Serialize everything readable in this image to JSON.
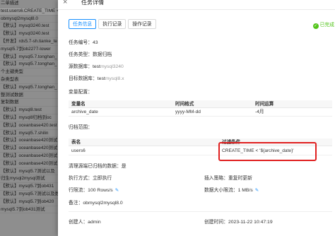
{
  "left_list": [
    "二单描述",
    "test.users6.CREATE_TIME <",
    "obmysql2mysql8.0",
    "【默认】mysql3240.test",
    "【默认】mysql3240.test",
    "【开发】rds5.7-sh.tianke_te",
    "mysql5.7到ob2277-lower",
    "【默认】mysql5.7.tonghan_",
    "【默认】mysql5.7.tonghan_",
    "个主键类型",
    "杂类型表",
    "【默认】mysql5.7.tonghan_",
    "整测试数据",
    "复制数据",
    "【默认】mysql8.test",
    "【默认】mysql8归档到oc",
    "【默认】oceanbase420.test",
    "【默认】mysql5.7.shilin",
    "【默认】oceanbase420测试",
    "【默认】oceanbase420测试",
    "【默认】oceanbase420测试",
    "【默认】oceanbase420测试",
    "【默认】mysql5.7测试以及",
    "归生mysql2mysql测试",
    "【默认】mysql5.7到ob431",
    "【默认】mysql5.7测试以及数据回滚",
    "【默认】mysql5.7到ob420",
    "mysql5.7到ob431测试"
  ],
  "drawer": {
    "close_icon": "×",
    "title": "任务详情",
    "tabs": [
      "任务信息",
      "执行记录",
      "操作记录"
    ],
    "status": "已完成",
    "task_no": "任务编号：43",
    "task_type": "任务类型：数据归档",
    "source_db_label": "源数据库：",
    "source_db_name": "test",
    "source_db_ds": "mysql3240",
    "target_db_label": "目标数据库：",
    "target_db_name": "test",
    "target_db_ds": "mysql8.x",
    "vars_title": "变量配置：",
    "vars_headers": [
      "变量名",
      "时间格式",
      "时间运算"
    ],
    "vars_rows": [
      [
        "archive_date",
        "yyyy-MM-dd",
        "-4月"
      ]
    ],
    "scope_title": "归档范围：",
    "scope_headers": [
      "表名",
      "过滤条件"
    ],
    "scope_rows": [
      [
        "users6",
        "CREATE_TIME < '${archive_date}'"
      ]
    ],
    "clean_source": "清理源端已归档的数据：是",
    "exec_mode": "执行方式：立即执行",
    "insert_strategy": "插入策略：重复时更新",
    "row_limit": "行限流：100  Rows/s",
    "data_limit": "数据大小限流：1  MB/s",
    "remark": "备注：obmysql2mysql8.0",
    "creator": "创建人：admin",
    "created_at": "创建时间：2023-11-22 10:47:19"
  },
  "colors": {
    "accent": "#1890ff",
    "success": "#52c41a",
    "highlight_box": "#e02020"
  }
}
